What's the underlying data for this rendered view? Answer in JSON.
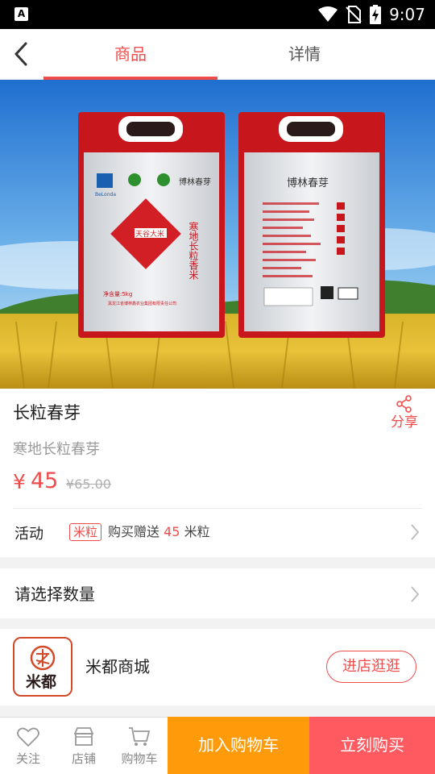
{
  "status_bar": {
    "time": "9:07",
    "app_icon_letter": "A"
  },
  "header": {
    "tabs": [
      {
        "label": "商品",
        "active": true
      },
      {
        "label": "详情",
        "active": false
      }
    ],
    "accent_color": "#f14c4c"
  },
  "product_image": {
    "front_bag": {
      "brand_logo": "BeLonda",
      "brand_name": "博林春芽",
      "diamond_text": "天谷大米",
      "vertical_slogan": "寒地长粒香米",
      "net_weight": "净含量:5kg",
      "company": "黑龙江省博林鑫农业集团有限责任公司"
    },
    "back_bag": {
      "brand_name": "博林春芽"
    }
  },
  "product": {
    "title": "长粒春芽",
    "subtitle": "寒地长粒春芽",
    "price_currency": "¥",
    "price": "45",
    "original_price": "¥65.00",
    "share_label": "分享"
  },
  "activity": {
    "label": "活动",
    "badge": "米粒",
    "text_prefix": "购买赠送",
    "points": "45",
    "text_suffix": "米粒"
  },
  "quantity": {
    "label": "请选择数量"
  },
  "shop": {
    "name": "米都商城",
    "logo_text": "米都",
    "enter_button": "进店逛逛"
  },
  "bottom_bar": {
    "follow_label": "关注",
    "store_label": "店铺",
    "cart_label": "购物车",
    "add_to_cart": "加入购物车",
    "buy_now": "立刻购买",
    "add_to_cart_color": "#ff9b0b",
    "buy_now_color": "#ff5a5f"
  }
}
